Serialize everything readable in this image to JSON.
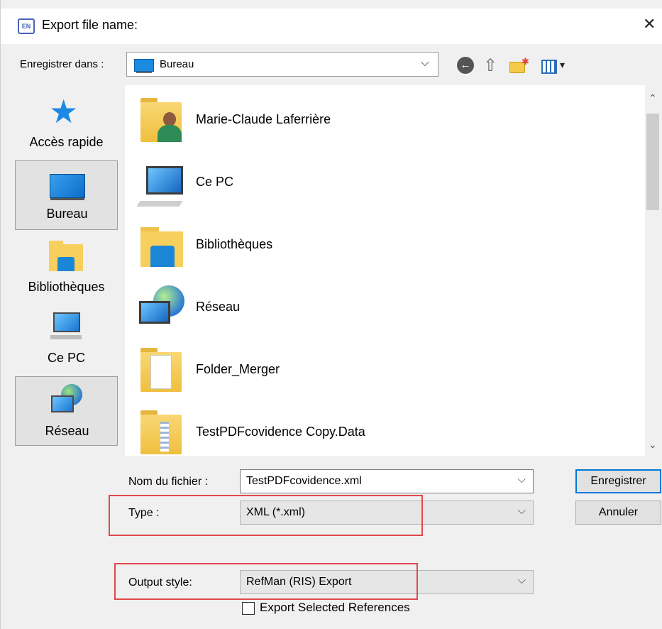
{
  "window": {
    "title": "Export file name:",
    "app_icon_text": "EN",
    "close_glyph": "✕"
  },
  "toolbar": {
    "save_in_label": "Enregistrer dans :",
    "location": "Bureau",
    "location_icon": "desktop-icon",
    "back_icon": "back-arrow-icon",
    "up_icon": "up-folder-icon",
    "new_folder_icon": "new-folder-icon",
    "views_icon": "views-menu-icon"
  },
  "places": [
    {
      "label": "Accès rapide",
      "icon": "star-icon"
    },
    {
      "label": "Bureau",
      "icon": "desktop-icon",
      "selected": true
    },
    {
      "label": "Bibliothèques",
      "icon": "libraries-icon"
    },
    {
      "label": "Ce PC",
      "icon": "computer-icon"
    },
    {
      "label": "Réseau",
      "icon": "network-icon"
    }
  ],
  "files": [
    {
      "name": "Marie-Claude Laferrière",
      "icon": "user-folder-icon"
    },
    {
      "name": "Ce PC",
      "icon": "computer-icon"
    },
    {
      "name": "Bibliothèques",
      "icon": "libraries-icon"
    },
    {
      "name": "Réseau",
      "icon": "network-icon"
    },
    {
      "name": "Folder_Merger",
      "icon": "folder-icon"
    },
    {
      "name": "TestPDFcovidence Copy.Data",
      "icon": "folder-icon"
    }
  ],
  "form": {
    "filename_label": "Nom du fichier :",
    "filename_value": "TestPDFcovidence.xml",
    "type_label": "Type :",
    "type_value": "XML (*.xml)",
    "output_style_label": "Output style:",
    "output_style_value": "RefMan (RIS) Export",
    "export_selected_label": "Export Selected References",
    "export_selected_checked": false
  },
  "buttons": {
    "save": "Enregistrer",
    "cancel": "Annuler"
  },
  "colors": {
    "highlight_box": "#e0484c",
    "default_button_border": "#0078d7"
  }
}
